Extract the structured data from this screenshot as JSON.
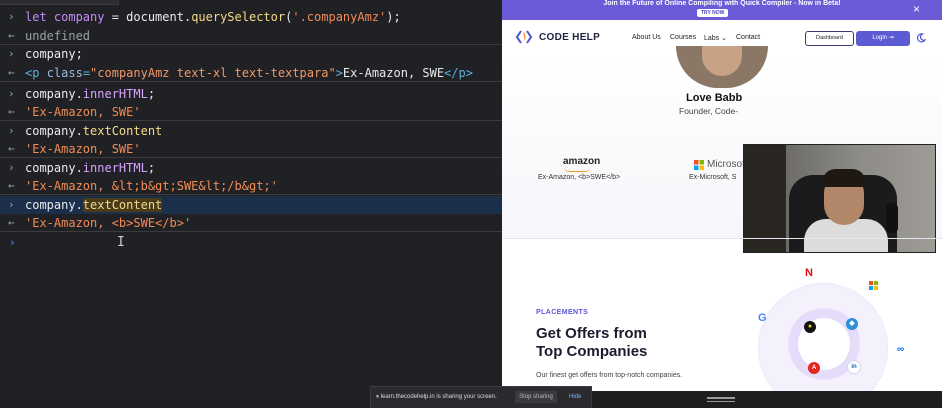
{
  "console": {
    "entries": [
      {
        "type": "input",
        "parts": [
          {
            "t": "let ",
            "c": "kw"
          },
          {
            "t": "company",
            "c": "kw"
          },
          {
            "t": " = document.",
            "c": ""
          },
          {
            "t": "querySelector",
            "c": "fn"
          },
          {
            "t": "(",
            "c": ""
          },
          {
            "t": "'.companyAmz'",
            "c": "str"
          },
          {
            "t": ");",
            "c": ""
          }
        ]
      },
      {
        "type": "output",
        "parts": [
          {
            "t": "undefined",
            "c": "und"
          }
        ]
      },
      {
        "type": "input",
        "parts": [
          {
            "t": "company;",
            "c": ""
          }
        ]
      },
      {
        "type": "output",
        "parts": [
          {
            "t": "  <p ",
            "c": "tag"
          },
          {
            "t": "class",
            "c": "attr"
          },
          {
            "t": "=",
            "c": "tag"
          },
          {
            "t": "\"companyAmz text-xl text-textpara\"",
            "c": "aval"
          },
          {
            "t": ">",
            "c": "tag"
          },
          {
            "t": "Ex-Amazon, SWE",
            "c": ""
          },
          {
            "t": "</p>",
            "c": "tag"
          }
        ]
      },
      {
        "type": "input",
        "parts": [
          {
            "t": "company.",
            "c": ""
          },
          {
            "t": "innerHTML",
            "c": "prop"
          },
          {
            "t": ";",
            "c": ""
          }
        ]
      },
      {
        "type": "output",
        "parts": [
          {
            "t": "'Ex-Amazon, SWE'",
            "c": "str2"
          }
        ]
      },
      {
        "type": "input",
        "parts": [
          {
            "t": "company.",
            "c": ""
          },
          {
            "t": "textContent",
            "c": "fn"
          }
        ]
      },
      {
        "type": "output",
        "parts": [
          {
            "t": "'Ex-Amazon, SWE'",
            "c": "str2"
          }
        ]
      },
      {
        "type": "input",
        "parts": [
          {
            "t": "company.",
            "c": ""
          },
          {
            "t": "innerHTML",
            "c": "prop"
          },
          {
            "t": ";",
            "c": ""
          }
        ]
      },
      {
        "type": "output",
        "parts": [
          {
            "t": "'Ex-Amazon, &lt;b&gt;SWE&lt;/b&gt;'",
            "c": "str2"
          }
        ]
      },
      {
        "type": "input",
        "highlight": true,
        "parts": [
          {
            "t": "company.",
            "c": ""
          },
          {
            "t": "textContent",
            "c": "fn hl"
          }
        ]
      },
      {
        "type": "output",
        "parts": [
          {
            "t": "'Ex-Amazon, <b>SWE</b>'",
            "c": "str2"
          }
        ]
      }
    ],
    "prompt_glyph": "›",
    "output_glyph": "←"
  },
  "site": {
    "banner_text": "Join the Future of Online Compiling with Quick Compiler - Now in Beta!",
    "banner_button": "TRY NOW",
    "banner_close": "×",
    "logo_text": "CODE HELP",
    "nav": [
      "About Us",
      "Courses",
      "Labs ⌄",
      "Contact"
    ],
    "dashboard_button": "Dashboard",
    "login_button": "Login ⇥",
    "mentor_name": "Love Babb",
    "mentor_role": "Founder, Code-",
    "company1_logo": "amazon",
    "company1_caption": "Ex-Amazon, <b>SWE</b>",
    "company2_logo": "Microsof",
    "company2_caption": "Ex-Microsoft, S",
    "placements_label": "PLACEMENTS",
    "heading_line1": "Get Offers from",
    "heading_line2": "Top Companies",
    "subtext": "Our finest get offers from top-notch companies.",
    "colors": {
      "accent": "#5d5bd4",
      "banner": "#6b5bd6",
      "netflix": "#e50914"
    }
  },
  "share_bar": {
    "text": "learn.thecodehelp.in is sharing your screen.",
    "stop_button": "Stop sharing",
    "hide_link": "Hide",
    "pause_icon": "⏸"
  }
}
